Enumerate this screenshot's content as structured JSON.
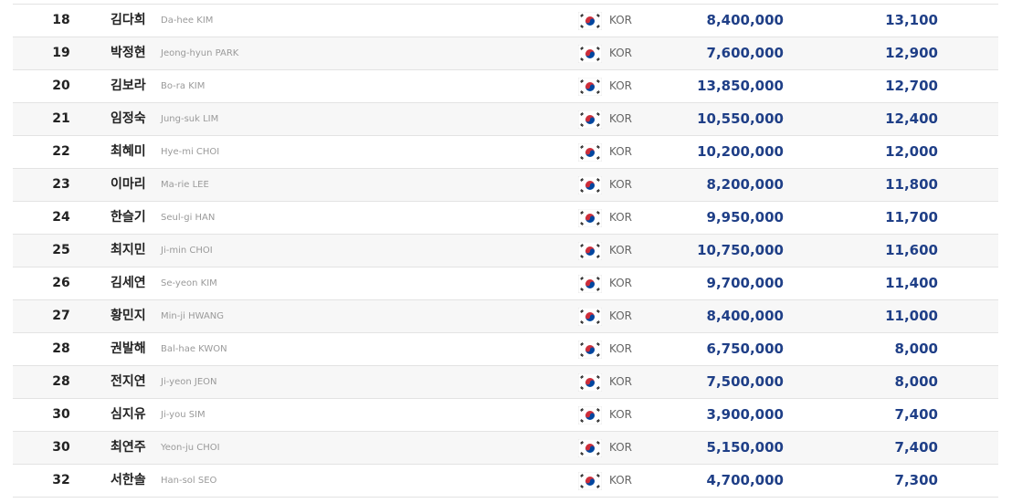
{
  "rankings": {
    "rows": [
      {
        "rank": "18",
        "name_kr": "김다희",
        "name_en": "Da-hee KIM",
        "country": "KOR",
        "prize": "8,400,000",
        "points": "13,100",
        "flag": "korea-flag-icon"
      },
      {
        "rank": "19",
        "name_kr": "박정현",
        "name_en": "Jeong-hyun PARK",
        "country": "KOR",
        "prize": "7,600,000",
        "points": "12,900",
        "flag": "korea-flag-icon"
      },
      {
        "rank": "20",
        "name_kr": "김보라",
        "name_en": "Bo-ra KIM",
        "country": "KOR",
        "prize": "13,850,000",
        "points": "12,700",
        "flag": "korea-flag-icon"
      },
      {
        "rank": "21",
        "name_kr": "임정숙",
        "name_en": "Jung-suk LIM",
        "country": "KOR",
        "prize": "10,550,000",
        "points": "12,400",
        "flag": "korea-flag-icon"
      },
      {
        "rank": "22",
        "name_kr": "최혜미",
        "name_en": "Hye-mi CHOI",
        "country": "KOR",
        "prize": "10,200,000",
        "points": "12,000",
        "flag": "korea-flag-icon"
      },
      {
        "rank": "23",
        "name_kr": "이마리",
        "name_en": "Ma-rie LEE",
        "country": "KOR",
        "prize": "8,200,000",
        "points": "11,800",
        "flag": "korea-flag-icon"
      },
      {
        "rank": "24",
        "name_kr": "한슬기",
        "name_en": "Seul-gi HAN",
        "country": "KOR",
        "prize": "9,950,000",
        "points": "11,700",
        "flag": "korea-flag-icon"
      },
      {
        "rank": "25",
        "name_kr": "최지민",
        "name_en": "Ji-min CHOI",
        "country": "KOR",
        "prize": "10,750,000",
        "points": "11,600",
        "flag": "korea-flag-icon"
      },
      {
        "rank": "26",
        "name_kr": "김세연",
        "name_en": "Se-yeon KIM",
        "country": "KOR",
        "prize": "9,700,000",
        "points": "11,400",
        "flag": "korea-flag-icon"
      },
      {
        "rank": "27",
        "name_kr": "황민지",
        "name_en": "Min-ji HWANG",
        "country": "KOR",
        "prize": "8,400,000",
        "points": "11,000",
        "flag": "korea-flag-icon"
      },
      {
        "rank": "28",
        "name_kr": "권발해",
        "name_en": "Bal-hae KWON",
        "country": "KOR",
        "prize": "6,750,000",
        "points": "8,000",
        "flag": "korea-flag-icon"
      },
      {
        "rank": "28",
        "name_kr": "전지연",
        "name_en": "Ji-yeon JEON",
        "country": "KOR",
        "prize": "7,500,000",
        "points": "8,000",
        "flag": "korea-flag-icon"
      },
      {
        "rank": "30",
        "name_kr": "심지유",
        "name_en": "Ji-you SIM",
        "country": "KOR",
        "prize": "3,900,000",
        "points": "7,400",
        "flag": "korea-flag-icon"
      },
      {
        "rank": "30",
        "name_kr": "최연주",
        "name_en": "Yeon-ju CHOI",
        "country": "KOR",
        "prize": "5,150,000",
        "points": "7,400",
        "flag": "korea-flag-icon"
      },
      {
        "rank": "32",
        "name_kr": "서한솔",
        "name_en": "Han-sol SEO",
        "country": "KOR",
        "prize": "4,700,000",
        "points": "7,300",
        "flag": "korea-flag-icon"
      }
    ]
  },
  "colors": {
    "value_blue": "#1f3f87",
    "row_alt_bg": "#f7f7f7",
    "divider": "#e3e3e3"
  }
}
